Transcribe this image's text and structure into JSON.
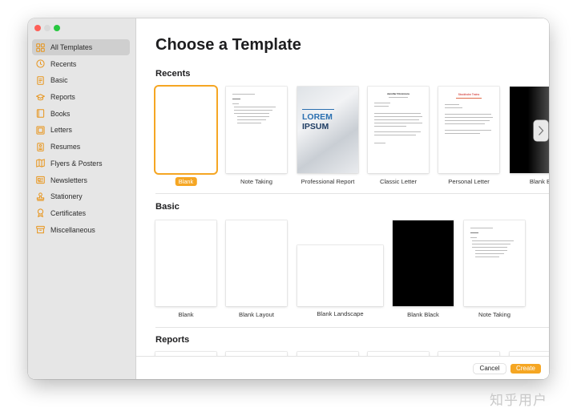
{
  "sidebar": {
    "items": [
      {
        "label": "All Templates",
        "icon": "grid-icon",
        "active": true
      },
      {
        "label": "Recents",
        "icon": "clock-icon"
      },
      {
        "label": "Basic",
        "icon": "document-icon"
      },
      {
        "label": "Reports",
        "icon": "graduation-cap-icon"
      },
      {
        "label": "Books",
        "icon": "book-icon"
      },
      {
        "label": "Letters",
        "icon": "letter-icon"
      },
      {
        "label": "Resumes",
        "icon": "resume-icon"
      },
      {
        "label": "Flyers & Posters",
        "icon": "flyer-icon"
      },
      {
        "label": "Newsletters",
        "icon": "newsletter-icon"
      },
      {
        "label": "Stationery",
        "icon": "stamp-icon"
      },
      {
        "label": "Certificates",
        "icon": "ribbon-icon"
      },
      {
        "label": "Miscellaneous",
        "icon": "box-icon"
      }
    ]
  },
  "main": {
    "title": "Choose a Template",
    "sections": {
      "recents": {
        "title": "Recents",
        "templates": [
          "Blank",
          "Note Taking",
          "Professional Report",
          "Classic Letter",
          "Personal Letter",
          "Blank B"
        ]
      },
      "basic": {
        "title": "Basic",
        "templates": [
          "Blank",
          "Blank Layout",
          "Blank Landscape",
          "Blank Black",
          "Note Taking"
        ]
      },
      "reports": {
        "title": "Reports"
      }
    },
    "cover_text": {
      "lorem": "LOREM",
      "ipsum": "IPSUM",
      "classic_letter_name": "Jennifer Fitzsimons",
      "personal_letter_name": "Stockholm Trains"
    }
  },
  "footer": {
    "cancel_label": "Cancel",
    "create_label": "Create"
  },
  "watermark": "知乎用户",
  "colors": {
    "accent": "#f5a623",
    "sidebar_bg": "#e6e6e6",
    "sidebar_active": "#cfcfcf",
    "icon": "#e8951c"
  }
}
